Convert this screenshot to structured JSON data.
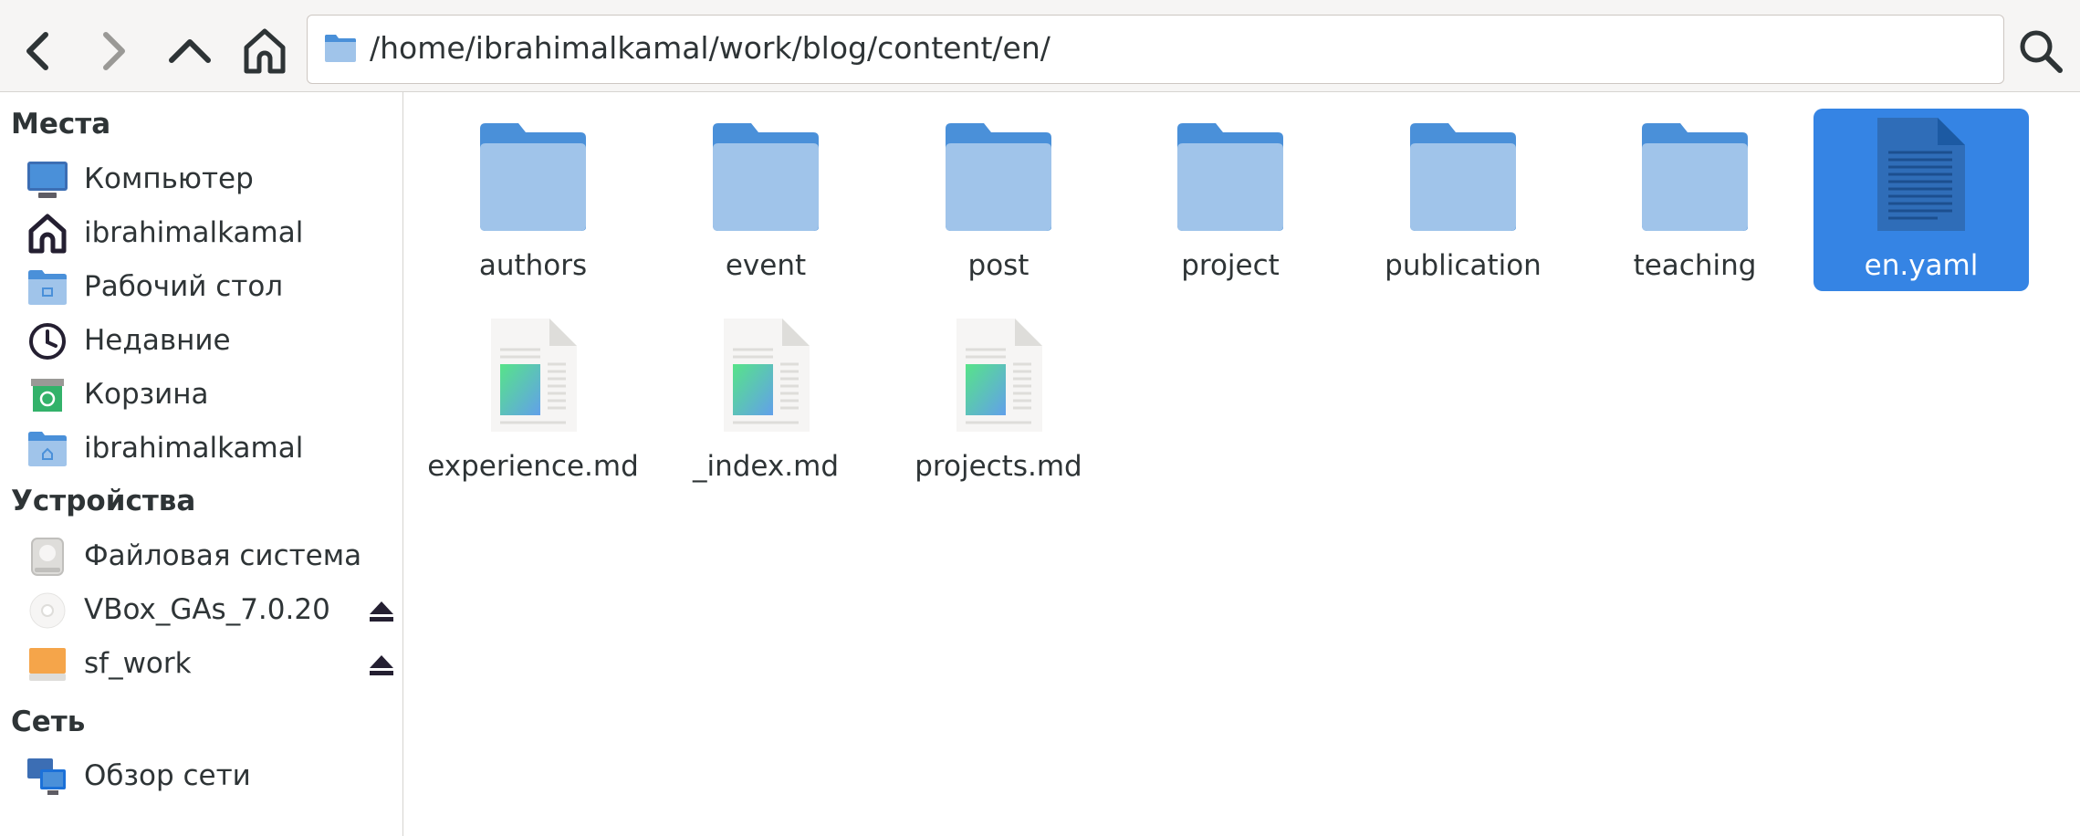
{
  "toolbar": {
    "path": "/home/ibrahimalkamal/work/blog/content/en/"
  },
  "sidebar": {
    "places_heading": "Места",
    "places": [
      {
        "label": "Компьютер",
        "icon": "computer-icon"
      },
      {
        "label": "ibrahimalkamal",
        "icon": "home-icon"
      },
      {
        "label": "Рабочий стол",
        "icon": "desktop-folder-icon"
      },
      {
        "label": "Недавние",
        "icon": "clock-icon"
      },
      {
        "label": "Корзина",
        "icon": "trash-icon"
      },
      {
        "label": "ibrahimalkamal",
        "icon": "home-folder-icon"
      }
    ],
    "devices_heading": "Устройства",
    "devices": [
      {
        "label": "Файловая система",
        "icon": "drive-icon"
      },
      {
        "label": "VBox_GAs_7.0.20",
        "icon": "optical-disc-icon",
        "eject": true
      },
      {
        "label": "sf_work",
        "icon": "removable-drive-icon",
        "eject": true
      }
    ],
    "network_heading": "Сеть",
    "network": [
      {
        "label": "Обзор сети",
        "icon": "network-icon"
      }
    ]
  },
  "files": [
    {
      "name": "authors",
      "type": "folder"
    },
    {
      "name": "event",
      "type": "folder"
    },
    {
      "name": "post",
      "type": "folder"
    },
    {
      "name": "project",
      "type": "folder"
    },
    {
      "name": "publication",
      "type": "folder"
    },
    {
      "name": "teaching",
      "type": "folder"
    },
    {
      "name": "en.yaml",
      "type": "text",
      "selected": true
    },
    {
      "name": "experience.md",
      "type": "markdown"
    },
    {
      "name": "_index.md",
      "type": "markdown"
    },
    {
      "name": "projects.md",
      "type": "markdown"
    }
  ],
  "colors": {
    "accent": "#3584e4",
    "folder": "#a0c4ea",
    "folder_tab": "#4a90d9"
  }
}
